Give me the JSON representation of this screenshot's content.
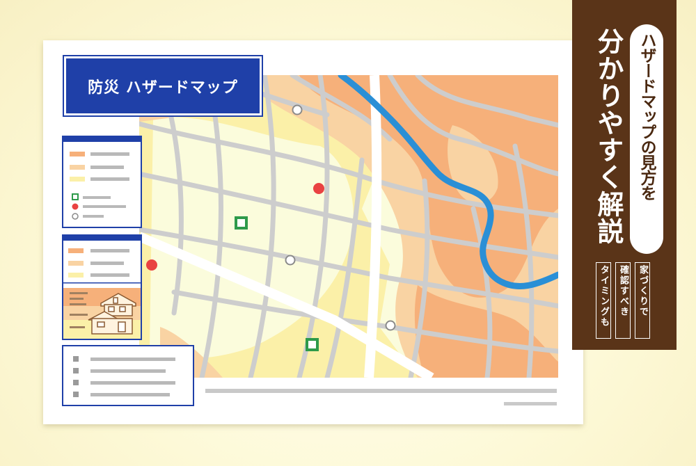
{
  "map_title": "防災 ハザードマップ",
  "badge": {
    "pill_text": "ハザードマップの見方を",
    "main_text": "分かりやすく解説",
    "sub_lines": [
      "家づくりで",
      "確認すべき",
      "タイミングも"
    ]
  },
  "colors": {
    "background": "#fdf9d7",
    "title_blue": "#1f40a8",
    "badge_brown": "#5a3418",
    "hazard_orange": "#f6b07a",
    "hazard_light_orange": "#f9d3a3",
    "hazard_yellow": "#fbf0a8",
    "river_blue": "#2a8fd6",
    "road_gray": "#cdcdcd",
    "shelter_green": "#2e9a4a",
    "facility_red": "#e94242"
  },
  "icons": [
    "green-square-marker-icon",
    "red-circle-marker-icon",
    "gray-circle-marker-icon",
    "house-icon"
  ]
}
